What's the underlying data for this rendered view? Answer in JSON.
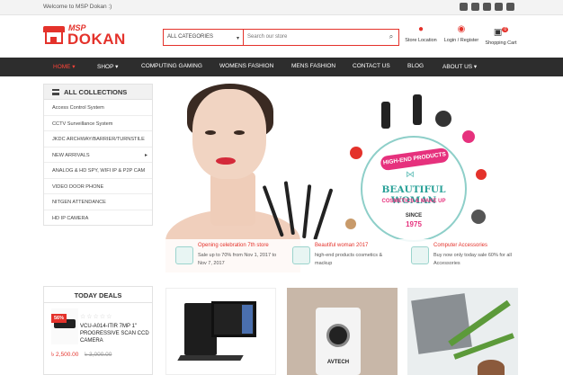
{
  "topbar": {
    "welcome": "Welcome to MSP Dokan :)",
    "social_icons": [
      "twitter-icon",
      "facebook-icon",
      "google-plus-icon",
      "instagram-icon",
      "youtube-icon"
    ]
  },
  "brand": {
    "top": "MSP",
    "name": "DOKAN",
    "color": "#e4322b"
  },
  "search": {
    "category": "ALL CATEGORIES",
    "placeholder": "Search our store"
  },
  "header_links": {
    "store_location": "Store Location",
    "login": "Login / Register",
    "cart": "Shopping Cart",
    "cart_count": "0"
  },
  "nav": [
    "HOME",
    "SHOP",
    "COMPUTING GAMING",
    "WOMENS FASHION",
    "MENS FASHION",
    "CONTACT US",
    "BLOG",
    "ABOUT US"
  ],
  "sidebar": {
    "title": "ALL COLLECTIONS",
    "items": [
      "Access Control System",
      "CCTV Surveillance System",
      "JKDC ARCHWAY/BARRIER/TURNSTILE",
      "NEW ARRIVALS",
      "ANALOG & HD SPY, WIFI IP & P2P CAM",
      "VIDEO DOOR PHONE",
      "NITGEN ATTENDANCE",
      "HD IP CAMERA"
    ]
  },
  "hero": {
    "badge_top": "HIGH-END PRODUCTS",
    "badge_main": "BEAUTIFUL WOMAN",
    "badge_sub": "COSMETICS & MAKE UP",
    "since": "SINCE",
    "year": "1975"
  },
  "promos": [
    {
      "title": "Opening celebration 7th store",
      "desc": "Sale up to 70% from Nov 1, 2017 to Nov 7, 2017"
    },
    {
      "title": "Beautiful woman 2017",
      "desc": "high-end products cosmetics & mackup"
    },
    {
      "title": "Computer Accessories",
      "desc": "Buy now only today sale 60% for all Accessories"
    }
  ],
  "deals": {
    "title": "TODAY DEALS",
    "badge": "56%",
    "stars": "☆☆☆☆☆",
    "name": "VCU-A014-ITIR 7MP 1\" PROGRESSIVE SCAN CCD CAMERA",
    "price": "৳ 2,500.00",
    "old_price": "৳ 3,000.00"
  },
  "product_brand": "AVTECH"
}
